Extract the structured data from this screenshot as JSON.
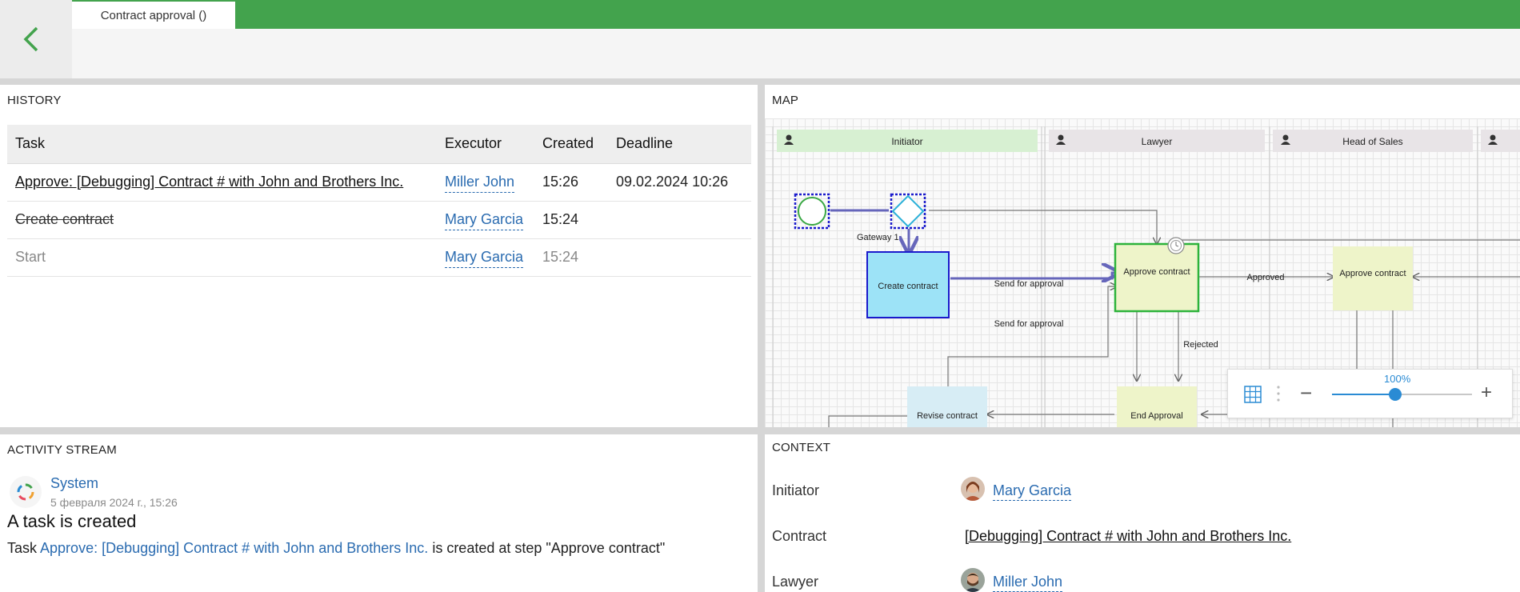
{
  "header": {
    "tab_label": "Contract approval ()"
  },
  "history": {
    "title": "HISTORY",
    "columns": [
      "Task",
      "Executor",
      "Created",
      "Deadline"
    ],
    "rows": [
      {
        "task": "Approve: [Debugging] Contract # with John and Brothers Inc.",
        "executor": "Miller John",
        "created": "15:26",
        "deadline": "09.02.2024 10:26"
      },
      {
        "task": "Create contract",
        "executor": "Mary Garcia",
        "created": "15:24",
        "deadline": ""
      },
      {
        "task": "Start",
        "executor": "Mary Garcia",
        "created": "15:24",
        "deadline": ""
      }
    ]
  },
  "map": {
    "title": "MAP",
    "lanes": [
      "Initiator",
      "Lawyer",
      "Head of Sales"
    ],
    "nodes": {
      "gateway": "Gateway 1",
      "create_contract": "Create contract",
      "approve_contract_1": "Approve contract",
      "approve_contract_2": "Approve contract",
      "revise_contract": "Revise contract",
      "end_approval": "End Approval"
    },
    "edges": {
      "send_for_approval_1": "Send for approval",
      "send_for_approval_2": "Send for approval",
      "approved": "Approved",
      "rejected": "Rejected"
    },
    "zoom": {
      "label": "100%",
      "level": 0.45
    }
  },
  "activity": {
    "title": "ACTIVITY STREAM",
    "author": "System",
    "date": "5 февраля 2024 г., 15:26",
    "headline": "A task is created",
    "text_prefix": "Task ",
    "task_link": "Approve: [Debugging] Contract #  with John and Brothers Inc.",
    "text_suffix": " is created at step \"Approve contract\""
  },
  "context": {
    "title": "CONTEXT",
    "initiator_label": "Initiator",
    "initiator_value": "Mary Garcia",
    "contract_label": "Contract",
    "contract_value": "[Debugging] Contract # with John and Brothers Inc.",
    "lawyer_label": "Lawyer",
    "lawyer_value": "Miller John"
  },
  "colors": {
    "brand_green": "#43a34d",
    "link_blue": "#2a6bb0",
    "task_active_fill": "#9de3f7",
    "task_approve_fill": "#eef4c9"
  }
}
